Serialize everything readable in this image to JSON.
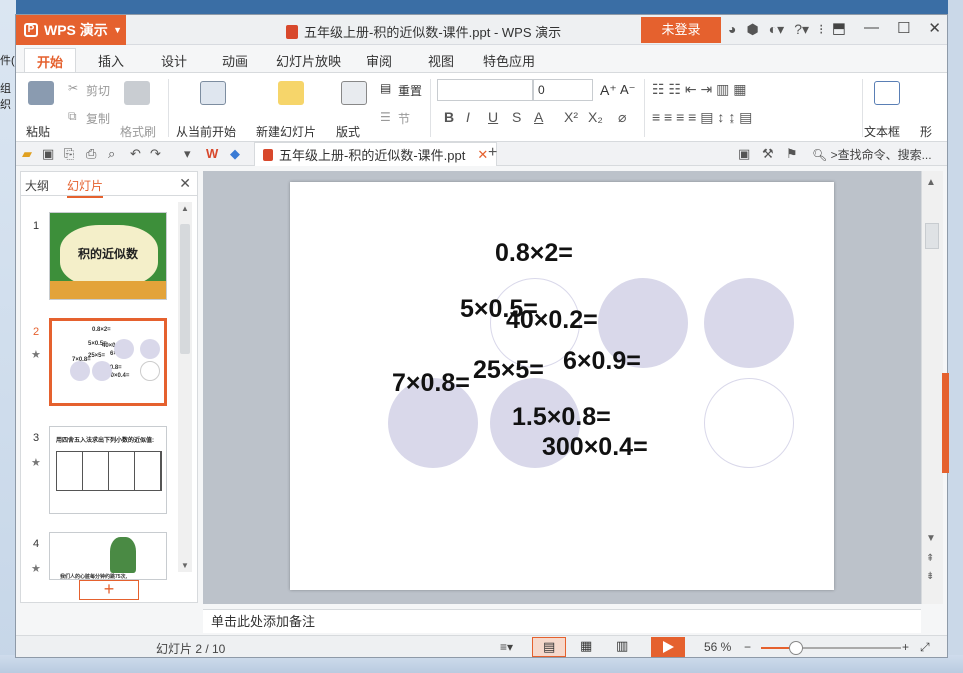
{
  "desktop": {
    "left_labels": [
      "件(",
      "组织"
    ]
  },
  "app": {
    "name": "WPS 演示",
    "window_title": "五年级上册-积的近似数-课件.ppt - WPS 演示",
    "login_label": "未登录",
    "help_label": "?"
  },
  "tabs": [
    "开始",
    "插入",
    "设计",
    "动画",
    "幻灯片放映",
    "审阅",
    "视图",
    "特色应用"
  ],
  "ribbon": {
    "paste": "粘贴",
    "cut": "剪切",
    "copy": "复制",
    "format_painter": "格式刷",
    "from_current": "从当前开始",
    "new_slide": "新建幻灯片",
    "layout": "版式",
    "reset": "重置",
    "section": "节",
    "font_name": "",
    "font_size": "0",
    "textbox": "文本框",
    "shape": "形"
  },
  "quickbar": {
    "doc_tab": "五年级上册-积的近似数-课件.ppt",
    "search": ">查找命令、搜索..."
  },
  "left_pane": {
    "tab_outline": "大纲",
    "tab_slides": "幻灯片",
    "slide_numbers": [
      "1",
      "2",
      "3",
      "4"
    ],
    "thumb1_title": "积的近似数",
    "thumb3_title": "用四舍五入法求出下列小数的近似值:",
    "thumb4_lines": [
      "我们人的心脏每分钟约跳75次,",
      "我们人的心脏每分钟约跳75次...",
      "那么我们每分钟人的心脏约跳多少次"
    ]
  },
  "slide": {
    "equations": [
      "0.8×2=",
      "5×0.5=",
      "40×0.2=",
      "25×5=",
      "6×0.9=",
      "7×0.8=",
      "1.5×0.8=",
      "300×0.4="
    ]
  },
  "notes_placeholder": "单击此处添加备注",
  "status": {
    "slide_info": "幻灯片 2 / 10",
    "zoom": "56 %",
    "zoom_level": 0.56
  },
  "colors": {
    "accent": "#e5612e",
    "circle": "#d9d8ea"
  }
}
